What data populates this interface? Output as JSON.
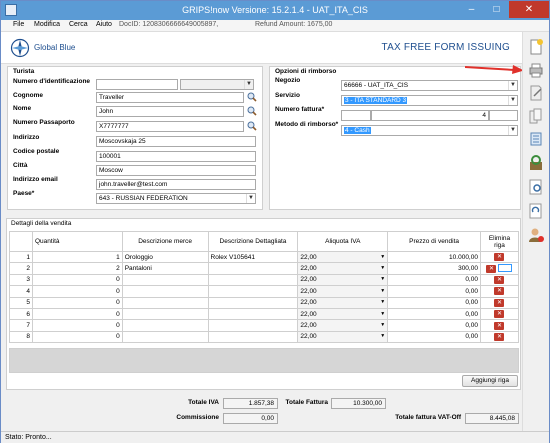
{
  "window": {
    "title": "GRIPS!now Versione: 15.2.1.4 - UAT_ITA_CIS"
  },
  "menu": {
    "file": "File",
    "modifica": "Modifica",
    "cerca": "Cerca",
    "aiuto": "Aiuto",
    "doc_id": "DocID: 1208306666649005897,",
    "refund": "Refund Amount: 1675,00"
  },
  "header": {
    "logo_text": "Global Blue",
    "form_title": "TAX FREE FORM ISSUING"
  },
  "tourist": {
    "section": "Turista",
    "id_label": "Numero d'identificazione",
    "id_value": "",
    "id_type": "",
    "surname_label": "Cognome",
    "surname": "Traveller",
    "name_label": "Nome",
    "name": "John",
    "passport_label": "Numero Passaporto",
    "passport": "X7777777",
    "address_label": "Indirizzo",
    "address": "Moscovskaja 25",
    "zip_label": "Codice postale",
    "zip": "100001",
    "city_label": "Città",
    "city": "Moscow",
    "email_label": "Indirizzo email",
    "email": "john.traveller@test.com",
    "country_label": "Paese*",
    "country": "643 - RUSSIAN FEDERATION"
  },
  "refund": {
    "section": "Opzioni di rimborso",
    "shop_label": "Negozio",
    "shop": "66666 - UAT_ITA_CIS",
    "service_label": "Servizio",
    "service": "3 - ITA STANDARD 3",
    "invoice_label": "Numero fattura*",
    "invoice_prefix": "",
    "invoice_number": "4",
    "invoice_suffix": "",
    "method_label": "Metodo di rimborso*",
    "method": "4 - Cash"
  },
  "sales": {
    "section": "Dettagli della vendita",
    "columns": {
      "qty": "Quantità",
      "desc": "Descrizione merce",
      "detail": "Descrizione Dettagliata",
      "vat": "Aliquota IVA",
      "price": "Prezzo di vendita",
      "delete": "Elimina riga"
    },
    "rows": [
      {
        "n": "1",
        "qty": "1",
        "desc": "Orologgio",
        "detail": "Rolex V105641",
        "vat": "22,00",
        "price": "10.000,00"
      },
      {
        "n": "2",
        "qty": "2",
        "desc": "Pantaloni",
        "detail": "",
        "vat": "22,00",
        "price": "300,00"
      },
      {
        "n": "3",
        "qty": "0",
        "desc": "",
        "detail": "",
        "vat": "22,00",
        "price": "0,00"
      },
      {
        "n": "4",
        "qty": "0",
        "desc": "",
        "detail": "",
        "vat": "22,00",
        "price": "0,00"
      },
      {
        "n": "5",
        "qty": "0",
        "desc": "",
        "detail": "",
        "vat": "22,00",
        "price": "0,00"
      },
      {
        "n": "6",
        "qty": "0",
        "desc": "",
        "detail": "",
        "vat": "22,00",
        "price": "0,00"
      },
      {
        "n": "7",
        "qty": "0",
        "desc": "",
        "detail": "",
        "vat": "22,00",
        "price": "0,00"
      },
      {
        "n": "8",
        "qty": "0",
        "desc": "",
        "detail": "",
        "vat": "22,00",
        "price": "0,00"
      }
    ],
    "add_row": "Aggiungi riga"
  },
  "totals": {
    "vat_label": "Totale IVA",
    "vat": "1.857,38",
    "invoice_label": "Totale Fattura",
    "invoice": "10.300,00",
    "commission_label": "Commissione",
    "commission": "0,00",
    "vat_off_label": "Totale fattura VAT-Off",
    "vat_off": "8.445,08"
  },
  "status": {
    "text": "Stato: Pronto..."
  },
  "sidebar_icons": [
    "new-document-icon",
    "print-icon",
    "edit-document-icon",
    "copy-document-icon",
    "list-icon",
    "refresh-icon",
    "search-document-icon",
    "sync-icon",
    "user-icon"
  ],
  "colors": {
    "titlebar": "#5b9bd5",
    "brand": "#1f4f8f",
    "accent_red": "#e0312b",
    "selection": "#3399ff"
  }
}
